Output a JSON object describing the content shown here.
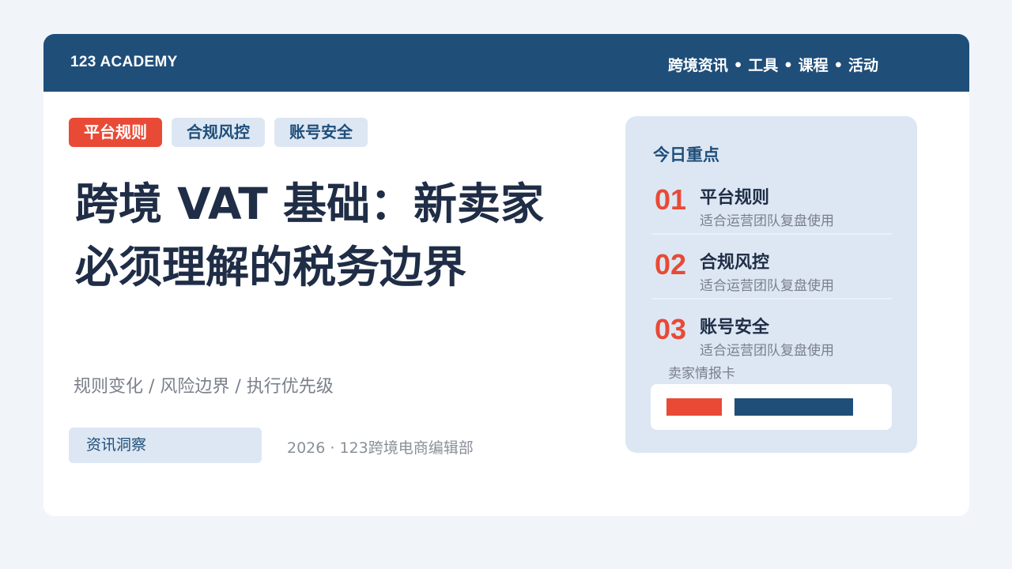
{
  "header": {
    "brand": "123 ACADEMY",
    "nav": "跨境资讯 • 工具 • 课程 • 活动"
  },
  "tags": [
    "平台规则",
    "合规风控",
    "账号安全"
  ],
  "title": "跨境 VAT 基础：新卖家必须理解的税务边界",
  "subtitle": "规则变化 / 风险边界 / 执行优先级",
  "footer": {
    "badge": "资讯洞察",
    "meta": "2026 · 123跨境电商编辑部"
  },
  "panel": {
    "title": "今日重点",
    "items": [
      {
        "num": "01",
        "name": "平台规则",
        "desc": "适合运营团队复盘使用"
      },
      {
        "num": "02",
        "name": "合规风控",
        "desc": "适合运营团队复盘使用"
      },
      {
        "num": "03",
        "name": "账号安全",
        "desc": "适合运营团队复盘使用"
      }
    ],
    "card_label": "卖家情报卡"
  },
  "colors": {
    "primary": "#1f4e79",
    "accent": "#e84a36",
    "light": "#dce7f3"
  }
}
